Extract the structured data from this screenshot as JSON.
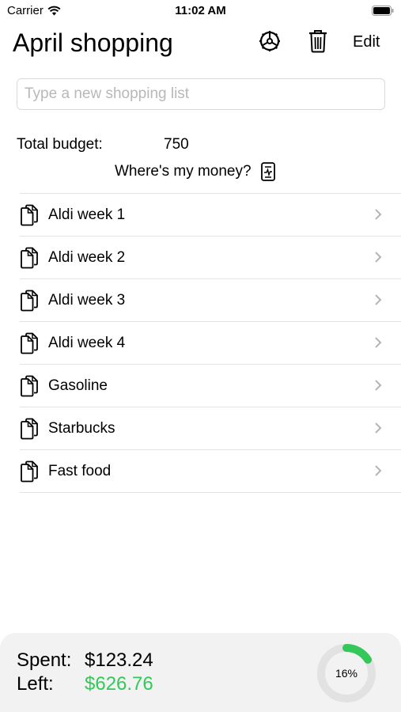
{
  "status": {
    "carrier": "Carrier",
    "time": "11:02 AM"
  },
  "header": {
    "title": "April shopping",
    "edit_label": "Edit"
  },
  "new_list": {
    "placeholder": "Type a new shopping list"
  },
  "budget": {
    "label": "Total budget:",
    "value": "750"
  },
  "money_link": {
    "label": "Where's my money?"
  },
  "lists": [
    {
      "label": "Aldi week 1"
    },
    {
      "label": "Aldi week 2"
    },
    {
      "label": "Aldi week 3"
    },
    {
      "label": "Aldi week 4"
    },
    {
      "label": "Gasoline"
    },
    {
      "label": "Starbucks"
    },
    {
      "label": "Fast food"
    }
  ],
  "summary": {
    "spent_label": "Spent:",
    "spent_value": "$123.24",
    "left_label": "Left:",
    "left_value": "$626.76",
    "percent_label": "16%",
    "percent_fraction": 0.16
  },
  "colors": {
    "accent_green": "#34c759",
    "ring_track": "#e2e2e2",
    "footer_bg": "#f2f2f2"
  },
  "icons": [
    "wifi-icon",
    "battery-icon",
    "settings-icon",
    "trash-icon",
    "report-icon",
    "document-icon",
    "chevron-right-icon"
  ]
}
